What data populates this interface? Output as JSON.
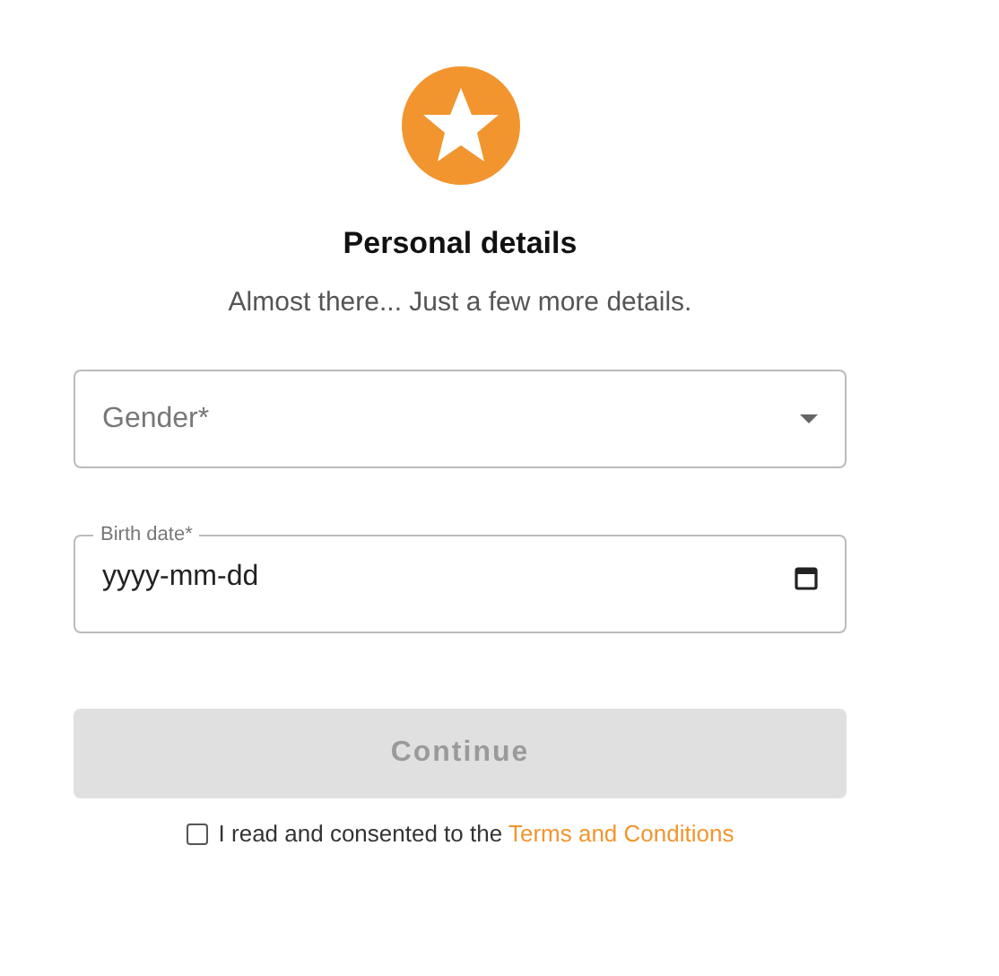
{
  "header": {
    "title": "Personal details",
    "subtitle": "Almost there... Just a few more details."
  },
  "fields": [
    {
      "kind": "select",
      "placeholder": "Gender*"
    },
    {
      "kind": "date",
      "label": "Birth date*",
      "placeholder": "yyyy-mm-dd"
    }
  ],
  "continue_button": {
    "label": "Continue",
    "disabled": true
  },
  "consent": {
    "checked": false,
    "text": "I read and consented to the",
    "link": "Terms and Conditions"
  }
}
